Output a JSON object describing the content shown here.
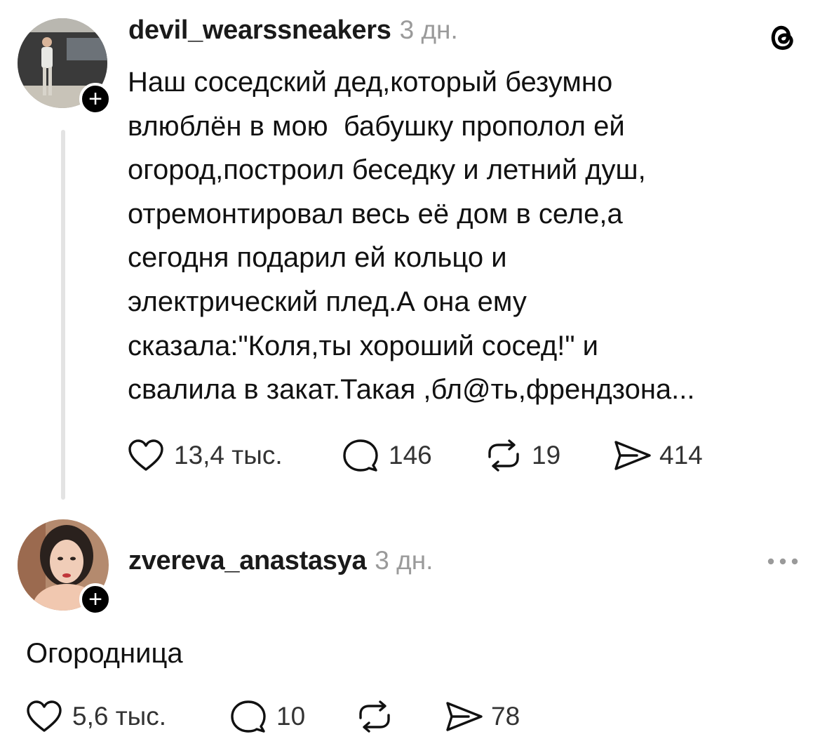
{
  "post": {
    "username": "devil_wearssneakers",
    "time": "3 дн.",
    "lines": [
      "Наш соседский дед,который безумно",
      "влюблён в мою  бабушку прополол ей",
      "огород,построил беседку и летний душ,",
      "отремонтировал весь её дом в селе,а",
      "сегодня подарил ей кольцо и",
      "электрический плед.А она ему",
      "сказала:\"Коля,ты хороший сосед!\" и",
      "свалила в закат.Такая ,бл@ть,френдзона..."
    ],
    "likes": "13,4 тыс.",
    "comments": "146",
    "reposts": "19",
    "shares": "414"
  },
  "reply": {
    "username": "zvereva_anastasya",
    "time": "3 дн.",
    "text": "Огородница",
    "likes": "5,6 тыс.",
    "comments": "10",
    "shares": "78"
  },
  "icons": {
    "app_logo": "threads-logo-icon",
    "follow": "plus-icon",
    "like": "heart-icon",
    "comment": "comment-bubble-icon",
    "repost": "repost-icon",
    "share": "send-icon",
    "more": "more-dots-icon"
  },
  "colors": {
    "text": "#111111",
    "muted": "#9a9a9a",
    "thread_line": "#e3e3e3",
    "badge": "#000000"
  }
}
